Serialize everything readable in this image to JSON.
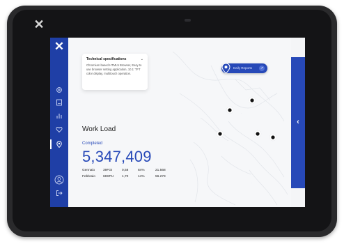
{
  "device": {
    "close_icon": "close-icon",
    "camera": "camera"
  },
  "sidebar": {
    "logo_icon": "x-logo-icon",
    "items": [
      {
        "icon": "gear-icon"
      },
      {
        "icon": "document-icon"
      },
      {
        "icon": "bar-chart-icon"
      },
      {
        "icon": "heart-icon"
      },
      {
        "icon": "location-pin-icon",
        "active": true
      }
    ],
    "bottom_items": [
      {
        "icon": "user-icon"
      },
      {
        "icon": "logout-icon"
      }
    ]
  },
  "spec_card": {
    "title": "Technical specifications",
    "body": "Chromium based HTML5 Browser, Easy to use browser setting application, 10.1' TFT color display, multitouch operation."
  },
  "daily_pill": {
    "label": "Daily Reports"
  },
  "workload": {
    "title": "Work Load",
    "completed_label": "Completed",
    "completed_value": "5,347,409",
    "rows": [
      {
        "month": "Gennaio",
        "code": "39FGI",
        "value": "0,58",
        "percent": "84%",
        "total": "21.568"
      },
      {
        "month": "Febbraio",
        "code": "68SPU",
        "value": "1,70",
        "percent": "14%",
        "total": "56.273"
      }
    ]
  },
  "colors": {
    "brand_blue": "#1f3fa6",
    "accent_blue": "#2749b8",
    "bezel": "#141416",
    "map_bg": "#f6f7f9"
  }
}
